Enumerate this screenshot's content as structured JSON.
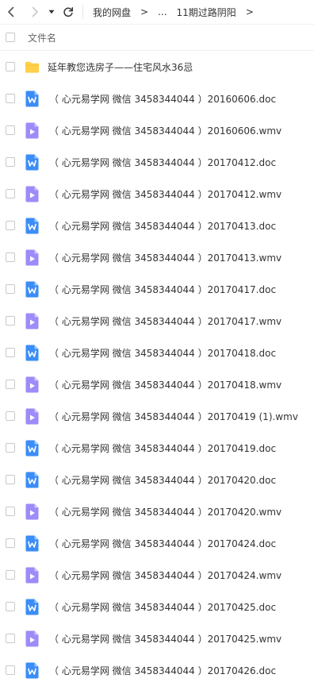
{
  "toolbar": {
    "back_icon": "chevron-left-icon",
    "forward_icon": "chevron-right-icon",
    "dropdown_icon": "caret-down-icon",
    "refresh_icon": "refresh-icon"
  },
  "breadcrumb": {
    "root": "我的网盘",
    "separator": ">",
    "ellipsis": "...",
    "current": "11期过路阴阳"
  },
  "list_header": {
    "column_name": "文件名"
  },
  "colors": {
    "folder": "#FFD04B",
    "doc_icon": "#3B8DF7",
    "video_icon": "#9E8BFA"
  },
  "files": [
    {
      "name": "延年教您选房子——住宅风水36忌",
      "type": "folder",
      "icon": "folder-icon"
    },
    {
      "name": "（ 心元易学网 微信 3458344044 ）20160606.doc",
      "type": "doc",
      "icon": "word-doc-icon"
    },
    {
      "name": "（ 心元易学网 微信 3458344044 ）20160606.wmv",
      "type": "video",
      "icon": "video-file-icon"
    },
    {
      "name": "（ 心元易学网 微信 3458344044 ）20170412.doc",
      "type": "doc",
      "icon": "word-doc-icon"
    },
    {
      "name": "（ 心元易学网 微信 3458344044 ）20170412.wmv",
      "type": "video",
      "icon": "video-file-icon"
    },
    {
      "name": "（ 心元易学网 微信 3458344044 ）20170413.doc",
      "type": "doc",
      "icon": "word-doc-icon"
    },
    {
      "name": "（ 心元易学网 微信 3458344044 ）20170413.wmv",
      "type": "video",
      "icon": "video-file-icon"
    },
    {
      "name": "（ 心元易学网 微信 3458344044 ）20170417.doc",
      "type": "doc",
      "icon": "word-doc-icon"
    },
    {
      "name": "（ 心元易学网 微信 3458344044 ）20170417.wmv",
      "type": "video",
      "icon": "video-file-icon"
    },
    {
      "name": "（ 心元易学网 微信 3458344044 ）20170418.doc",
      "type": "doc",
      "icon": "word-doc-icon"
    },
    {
      "name": "（ 心元易学网 微信 3458344044 ）20170418.wmv",
      "type": "video",
      "icon": "video-file-icon"
    },
    {
      "name": "（ 心元易学网 微信 3458344044 ）20170419 (1).wmv",
      "type": "video",
      "icon": "video-file-icon"
    },
    {
      "name": "（ 心元易学网 微信 3458344044 ）20170419.doc",
      "type": "doc",
      "icon": "word-doc-icon"
    },
    {
      "name": "（ 心元易学网 微信 3458344044 ）20170420.doc",
      "type": "doc",
      "icon": "word-doc-icon"
    },
    {
      "name": "（ 心元易学网 微信 3458344044 ）20170420.wmv",
      "type": "video",
      "icon": "video-file-icon"
    },
    {
      "name": "（ 心元易学网 微信 3458344044 ）20170424.doc",
      "type": "doc",
      "icon": "word-doc-icon"
    },
    {
      "name": "（ 心元易学网 微信 3458344044 ）20170424.wmv",
      "type": "video",
      "icon": "video-file-icon"
    },
    {
      "name": "（ 心元易学网 微信 3458344044 ）20170425.doc",
      "type": "doc",
      "icon": "word-doc-icon"
    },
    {
      "name": "（ 心元易学网 微信 3458344044 ）20170425.wmv",
      "type": "video",
      "icon": "video-file-icon"
    },
    {
      "name": "（ 心元易学网 微信 3458344044 ）20170426.doc",
      "type": "doc",
      "icon": "word-doc-icon"
    }
  ]
}
